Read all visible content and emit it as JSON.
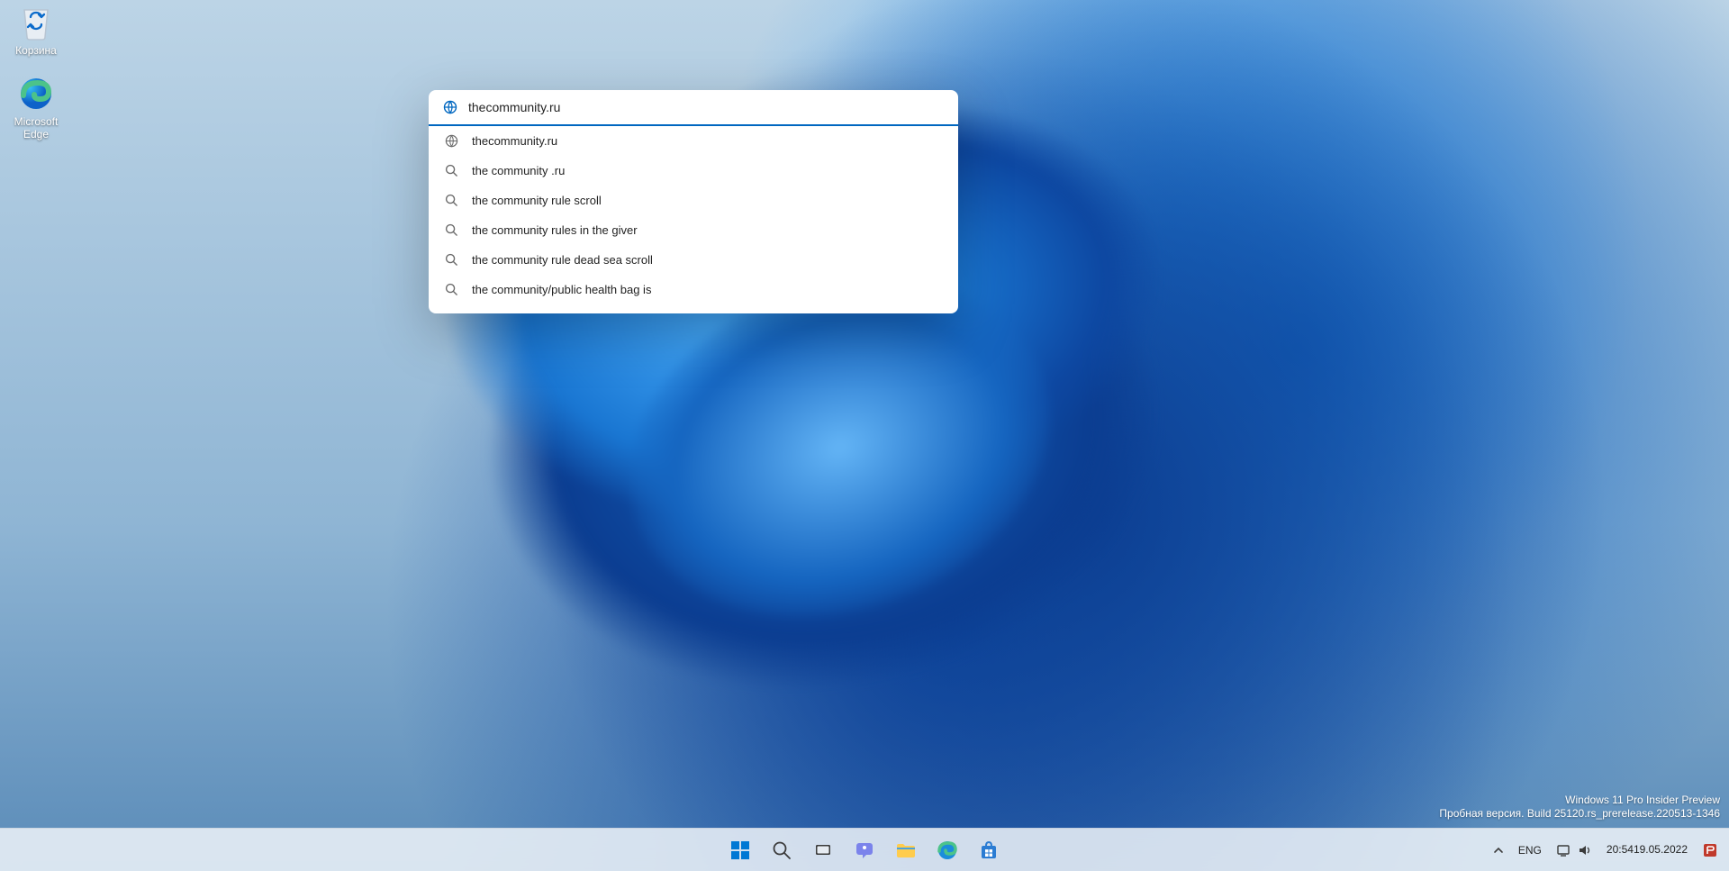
{
  "desktop_icons": {
    "recycle_bin": {
      "label": "Корзина"
    },
    "edge": {
      "label": "Microsoft Edge"
    }
  },
  "search": {
    "input_value": "thecommunity.ru",
    "suggestions": [
      {
        "icon": "globe",
        "text": "thecommunity.ru"
      },
      {
        "icon": "search",
        "text": "the community .ru"
      },
      {
        "icon": "search",
        "text": "the community rule scroll"
      },
      {
        "icon": "search",
        "text": "the community rules in the giver"
      },
      {
        "icon": "search",
        "text": "the community rule dead sea scroll"
      },
      {
        "icon": "search",
        "text": "the community/public health bag is"
      }
    ]
  },
  "watermark": {
    "line1": "Windows 11 Pro Insider Preview",
    "line2": "Пробная версия. Build 25120.rs_prerelease.220513-1346"
  },
  "taskbar": {
    "buttons": [
      {
        "name": "start"
      },
      {
        "name": "search"
      },
      {
        "name": "task-view"
      },
      {
        "name": "chat"
      },
      {
        "name": "file-explorer"
      },
      {
        "name": "edge"
      },
      {
        "name": "store"
      }
    ]
  },
  "systray": {
    "chevron": "^",
    "language": "ENG",
    "time": "20:54",
    "date": "19.05.2022"
  }
}
